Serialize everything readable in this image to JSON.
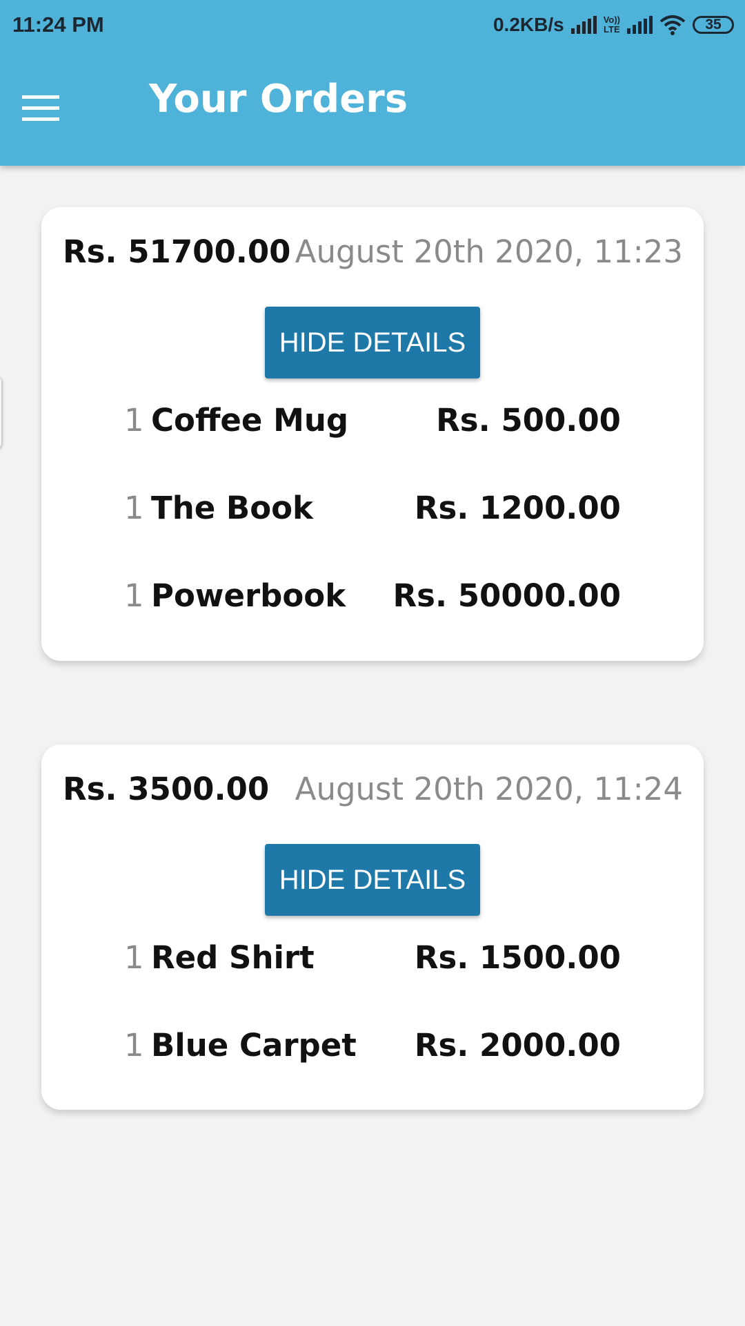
{
  "status_bar": {
    "time": "11:24 PM",
    "net_speed": "0.2KB/s",
    "volte_line1": "Vo))",
    "volte_line2": "LTE",
    "battery": "35"
  },
  "app_bar": {
    "title": "Your Orders",
    "menu_icon": "hamburger-menu-icon"
  },
  "orders": [
    {
      "total": "Rs. 51700.00",
      "date": "August 20th 2020, 11:23",
      "toggle_label": "HIDE DETAILS",
      "items": [
        {
          "qty": "1",
          "name": "Coffee Mug",
          "price": "Rs. 500.00"
        },
        {
          "qty": "1",
          "name": "The Book",
          "price": "Rs. 1200.00"
        },
        {
          "qty": "1",
          "name": "Powerbook",
          "price": "Rs. 50000.00"
        }
      ]
    },
    {
      "total": "Rs. 3500.00",
      "date": "August 20th 2020, 11:24",
      "toggle_label": "HIDE DETAILS",
      "items": [
        {
          "qty": "1",
          "name": "Red Shirt",
          "price": "Rs. 1500.00"
        },
        {
          "qty": "1",
          "name": "Blue Carpet",
          "price": "Rs. 2000.00"
        }
      ]
    }
  ],
  "colors": {
    "app_bar": "#4fb3d9",
    "button": "#1e79a9",
    "background": "#f2f2f2"
  }
}
